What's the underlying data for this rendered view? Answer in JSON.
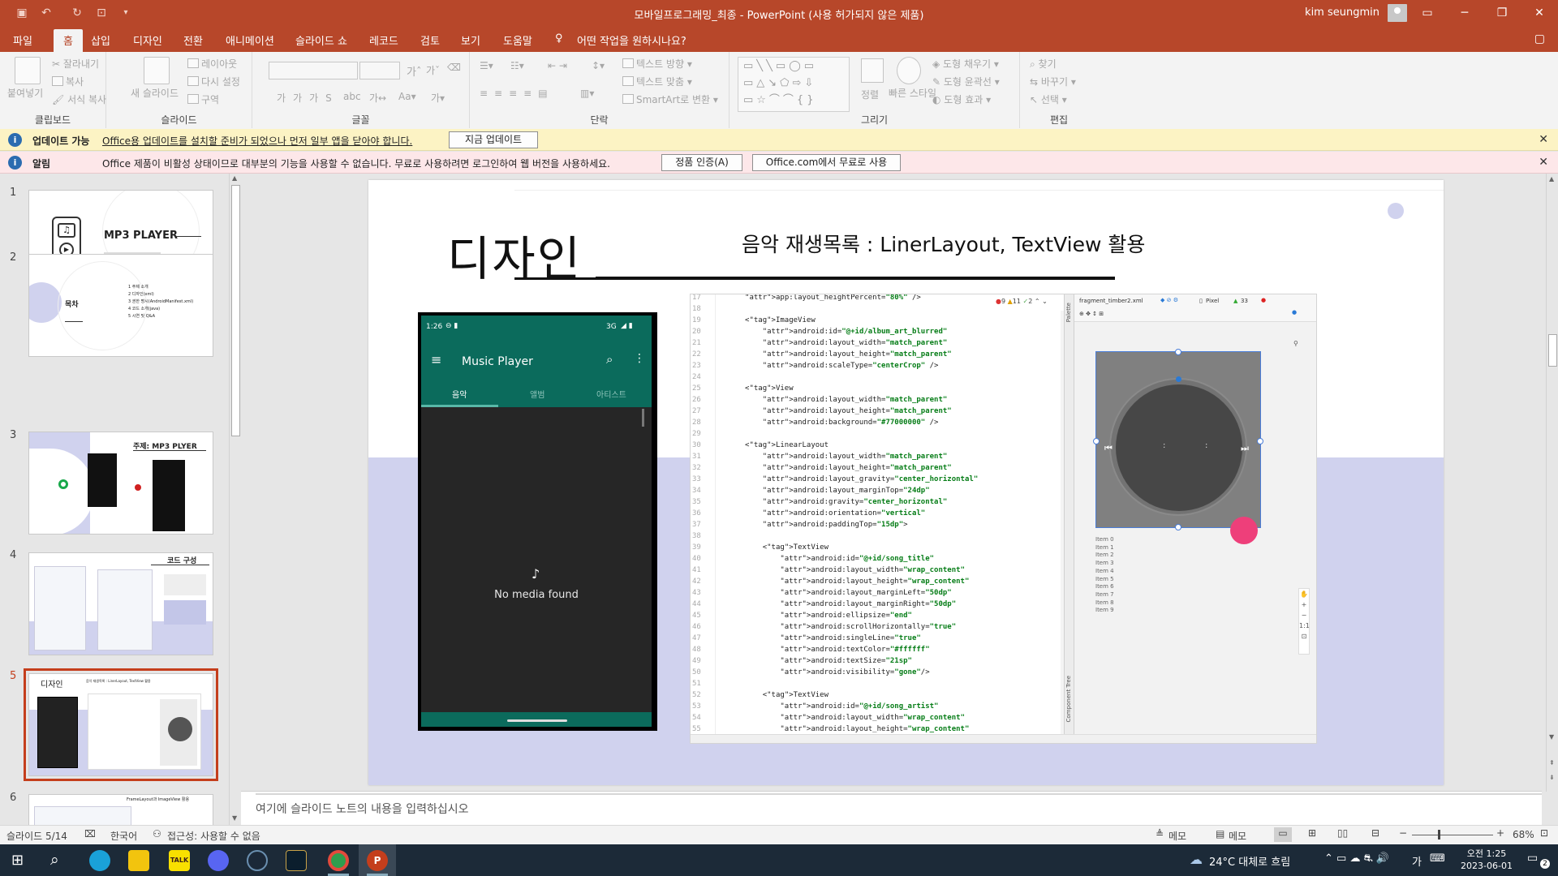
{
  "window": {
    "title": "모바일프로그래밍_최종  -  PowerPoint (사용 허가되지 않은 제품)",
    "user": "kim seungmin"
  },
  "menu_tabs": [
    "파일",
    "홈",
    "삽입",
    "디자인",
    "전환",
    "애니메이션",
    "슬라이드 쇼",
    "레코드",
    "검토",
    "보기",
    "도움말"
  ],
  "tell_me": "어떤 작업을 원하시나요?",
  "ribbon": {
    "clipboard": {
      "label": "클립보드",
      "paste": "붙여넣기",
      "cut": "잘라내기",
      "copy": "복사",
      "format_painter": "서식 복사"
    },
    "slides": {
      "label": "슬라이드",
      "new_slide": "새 슬라이드",
      "layout": "레이아웃",
      "reset": "다시 설정",
      "section": "구역"
    },
    "font": {
      "label": "글꼴"
    },
    "paragraph": {
      "label": "단락",
      "text_direction": "텍스트 방향",
      "align_text": "텍스트 맞춤",
      "smartart": "SmartArt로 변환"
    },
    "drawing": {
      "label": "그리기",
      "arrange": "정렬",
      "quick_styles": "빠른 스타일",
      "fill": "도형 채우기",
      "outline": "도형 윤곽선",
      "effects": "도형 효과"
    },
    "editing": {
      "label": "편집",
      "find": "찾기",
      "replace": "바꾸기",
      "select": "선택"
    }
  },
  "update_bar": {
    "title": "업데이트 가능",
    "message": "Office용 업데이트를 설치할 준비가 되었으나 먼저 일부 앱을 닫아야 합니다.",
    "button": "지금 업데이트"
  },
  "alert_bar": {
    "title": "알림",
    "message": "Office 제품이 비활성 상태이므로 대부분의 기능을 사용할 수 없습니다. 무료로 사용하려면 로그인하여 웹 버전을 사용하세요.",
    "button1": "정품 인증(A)",
    "button2": "Office.com에서 무료로 사용"
  },
  "thumbnails": [
    {
      "num": "1",
      "title": "MP3 PLAYER"
    },
    {
      "num": "2",
      "title": "목차",
      "items": [
        "1  주제 소개",
        "2  디자인(xml)",
        "3  권한 명시(AndroidManifest.xml)",
        "4  코드 소개(java)",
        "5  시연 및 Q&A"
      ]
    },
    {
      "num": "3",
      "title": "주제: MP3 PLYER"
    },
    {
      "num": "4",
      "title": "코드 구성"
    },
    {
      "num": "5",
      "title": "디자인",
      "subtitle": "음악 재생목록 : LinerLayout, TextView 활용"
    },
    {
      "num": "6",
      "title": "FrameLayout과 ImageView 활용"
    }
  ],
  "slide": {
    "title": "디자인",
    "subtitle": "음악 재생목록 :  LinerLayout, TextView 활용",
    "phone": {
      "time": "1:26",
      "signal": "3G",
      "app_title": "Music Player",
      "tabs": [
        "음악",
        "앨범",
        "아티스트"
      ],
      "empty_text": "No media found"
    },
    "ide": {
      "file_tab": "fragment_timber2.xml",
      "device": "Pixel",
      "api": "33",
      "warnings": "9",
      "errors": "11",
      "checks": "2",
      "list_items": [
        "Item 0",
        "Item 1",
        "Item 2",
        "Item 3",
        "Item 4",
        "Item 5",
        "Item 6",
        "Item 7",
        "Item 8",
        "Item 9"
      ],
      "palette": "Palette",
      "component_tree": "Component Tree",
      "code_lines": [
        {
          "n": "17",
          "t": "    app:layout_heightPercent=\"80%\" />"
        },
        {
          "n": "18",
          "t": ""
        },
        {
          "n": "19",
          "t": "    <ImageView"
        },
        {
          "n": "20",
          "t": "        android:id=\"@+id/album_art_blurred\""
        },
        {
          "n": "21",
          "t": "        android:layout_width=\"match_parent\""
        },
        {
          "n": "22",
          "t": "        android:layout_height=\"match_parent\""
        },
        {
          "n": "23",
          "t": "        android:scaleType=\"centerCrop\" />"
        },
        {
          "n": "24",
          "t": ""
        },
        {
          "n": "25",
          "t": "    <View"
        },
        {
          "n": "26",
          "t": "        android:layout_width=\"match_parent\""
        },
        {
          "n": "27",
          "t": "        android:layout_height=\"match_parent\""
        },
        {
          "n": "28",
          "t": "        android:background=\"#77000000\" />"
        },
        {
          "n": "29",
          "t": ""
        },
        {
          "n": "30",
          "t": "    <LinearLayout"
        },
        {
          "n": "31",
          "t": "        android:layout_width=\"match_parent\""
        },
        {
          "n": "32",
          "t": "        android:layout_height=\"match_parent\""
        },
        {
          "n": "33",
          "t": "        android:layout_gravity=\"center_horizontal\""
        },
        {
          "n": "34",
          "t": "        android:layout_marginTop=\"24dp\""
        },
        {
          "n": "35",
          "t": "        android:gravity=\"center_horizontal\""
        },
        {
          "n": "36",
          "t": "        android:orientation=\"vertical\""
        },
        {
          "n": "37",
          "t": "        android:paddingTop=\"15dp\">"
        },
        {
          "n": "38",
          "t": ""
        },
        {
          "n": "39",
          "t": "        <TextView"
        },
        {
          "n": "40",
          "t": "            android:id=\"@+id/song_title\""
        },
        {
          "n": "41",
          "t": "            android:layout_width=\"wrap_content\""
        },
        {
          "n": "42",
          "t": "            android:layout_height=\"wrap_content\""
        },
        {
          "n": "43",
          "t": "            android:layout_marginLeft=\"50dp\""
        },
        {
          "n": "44",
          "t": "            android:layout_marginRight=\"50dp\""
        },
        {
          "n": "45",
          "t": "            android:ellipsize=\"end\""
        },
        {
          "n": "46",
          "t": "            android:scrollHorizontally=\"true\""
        },
        {
          "n": "47",
          "t": "            android:singleLine=\"true\""
        },
        {
          "n": "48",
          "t": "            android:textColor=\"#ffffff\""
        },
        {
          "n": "49",
          "t": "            android:textSize=\"21sp\""
        },
        {
          "n": "50",
          "t": "            android:visibility=\"gone\"/>"
        },
        {
          "n": "51",
          "t": ""
        },
        {
          "n": "52",
          "t": "        <TextView"
        },
        {
          "n": "53",
          "t": "            android:id=\"@+id/song_artist\""
        },
        {
          "n": "54",
          "t": "            android:layout_width=\"wrap_content\""
        },
        {
          "n": "55",
          "t": "            android:layout_height=\"wrap_content\""
        }
      ]
    }
  },
  "notes_placeholder": "여기에 슬라이드 노트의 내용을 입력하십시오",
  "status": {
    "slide_of": "슬라이드 5/14",
    "language": "한국어",
    "accessibility": "접근성: 사용할 수 없음",
    "notes_btn": "메모",
    "comments_btn": "메모",
    "zoom": "68%"
  },
  "taskbar": {
    "weather": "24°C  대체로 흐림",
    "ime": "가",
    "time": "오전 1:25",
    "date": "2023-06-01",
    "notif_count": "2"
  },
  "colors": {
    "accent": "#b7472a",
    "selection": "#c43e1c",
    "android_teal": "#0b6b5c",
    "lavender": "#d0d2ee"
  }
}
